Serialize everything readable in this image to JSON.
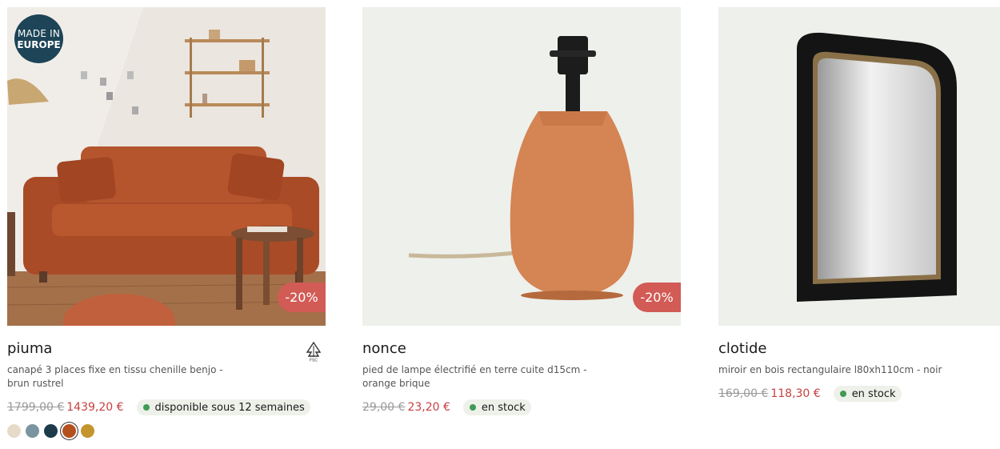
{
  "products": [
    {
      "badge": {
        "line1": "MADE IN",
        "line2": "EUROPE"
      },
      "discount": "-20%",
      "title": "piuma",
      "description": "canapé 3 places fixe en tissu chenille benjo - brun rustrel",
      "old_price": "1799,00 €",
      "new_price": "1439,20 €",
      "stock": "disponible sous 12 semaines",
      "icon": "fsc-tree-icon",
      "swatches": [
        {
          "color": "#e6dbc8"
        },
        {
          "color": "#7b95a0"
        },
        {
          "color": "#1d3b4a"
        },
        {
          "color": "#b4501e",
          "selected": true
        },
        {
          "color": "#c4952e"
        }
      ]
    },
    {
      "discount": "-20%",
      "title": "nonce",
      "description": "pied de lampe électrifié en terre cuite d15cm - orange brique",
      "old_price": "29,00 €",
      "new_price": "23,20 €",
      "stock": "en stock"
    },
    {
      "title": "clotide",
      "description": "miroir en bois rectangulaire l80xh110cm - noir",
      "old_price": "169,00 €",
      "new_price": "118,30 €",
      "stock": "en stock"
    }
  ],
  "colors": {
    "discount": "#d25b55",
    "price": "#c74040",
    "stock_dot": "#3f9a55",
    "badge": "#1d4457"
  }
}
